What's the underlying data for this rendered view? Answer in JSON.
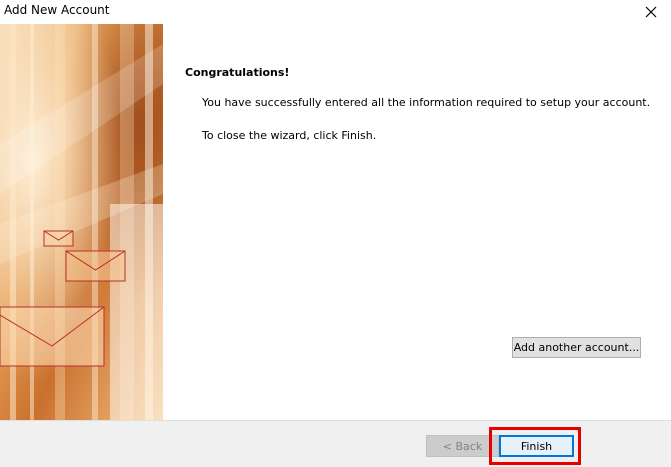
{
  "window": {
    "title": "Add New Account",
    "close_glyph": "✕"
  },
  "content": {
    "heading": "Congratulations!",
    "message_success": "You have successfully entered all the information required to setup your account.",
    "message_close": "To close the wizard, click Finish.",
    "add_account_label": "Add another account..."
  },
  "footer": {
    "back_label": "< Back",
    "finish_label": "Finish"
  },
  "icons": {
    "close": "close-icon",
    "banner": "mail-envelopes-banner"
  },
  "colors": {
    "finish_border": "#0078d7",
    "highlight": "#e60000",
    "banner_orange": "#d9822b"
  }
}
